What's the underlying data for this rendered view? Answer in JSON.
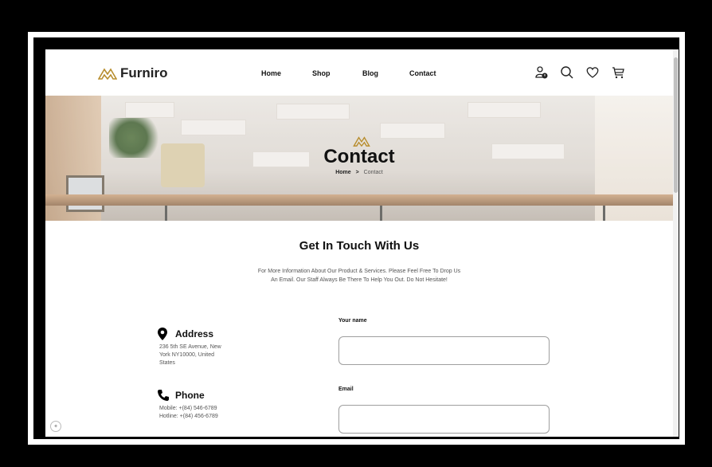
{
  "brand": {
    "name": "Furniro",
    "accent": "#B88E2F"
  },
  "nav": {
    "items": [
      "Home",
      "Shop",
      "Blog",
      "Contact"
    ]
  },
  "header_icons": [
    "account-alert-icon",
    "search-icon",
    "heart-icon",
    "cart-icon"
  ],
  "hero": {
    "title": "Contact",
    "breadcrumb_home": "Home",
    "breadcrumb_sep": ">",
    "breadcrumb_current": "Contact"
  },
  "section": {
    "title": "Get In Touch With Us",
    "description_line1": "For More Information About Our Product & Services. Please Feel Free To Drop Us",
    "description_line2": "An Email. Our Staff Always Be There To Help You Out. Do Not Hesitate!"
  },
  "info": {
    "address_title": "Address",
    "address_line1": "236 5th SE Avenue, New",
    "address_line2": "York NY10000, United",
    "address_line3": "States",
    "phone_title": "Phone",
    "phone_mobile": "Mobile: +(84) 546-6789",
    "phone_hotline": "Hotline: +(84) 456-6789"
  },
  "form": {
    "name_label": "Your name",
    "name_value": "",
    "email_label": "Email",
    "email_value": ""
  }
}
